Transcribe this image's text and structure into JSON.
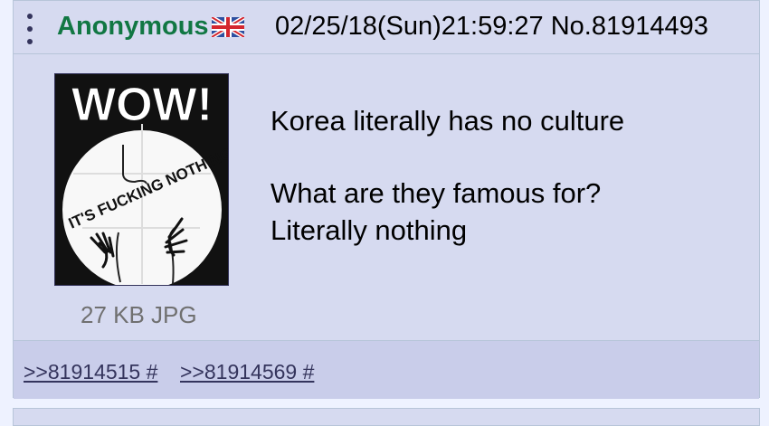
{
  "post": {
    "name": "Anonymous",
    "flag_icon": "uk-flag-icon",
    "datetime": "02/25/18(Sun)21:59:27 No.81914493",
    "image_text": "WOW!",
    "image_caption": "IT'S FUCKING NOTHING",
    "file_info": "27 KB JPG",
    "message_lines": [
      "Korea literally has no culture",
      "What are they famous for?",
      "Literally nothing"
    ],
    "replies": [
      ">>81914515 #",
      ">>81914569 #"
    ]
  },
  "colors": {
    "name": "#117743",
    "background": "#d6daf0",
    "footer": "#c9cdea",
    "link": "#34345c"
  }
}
